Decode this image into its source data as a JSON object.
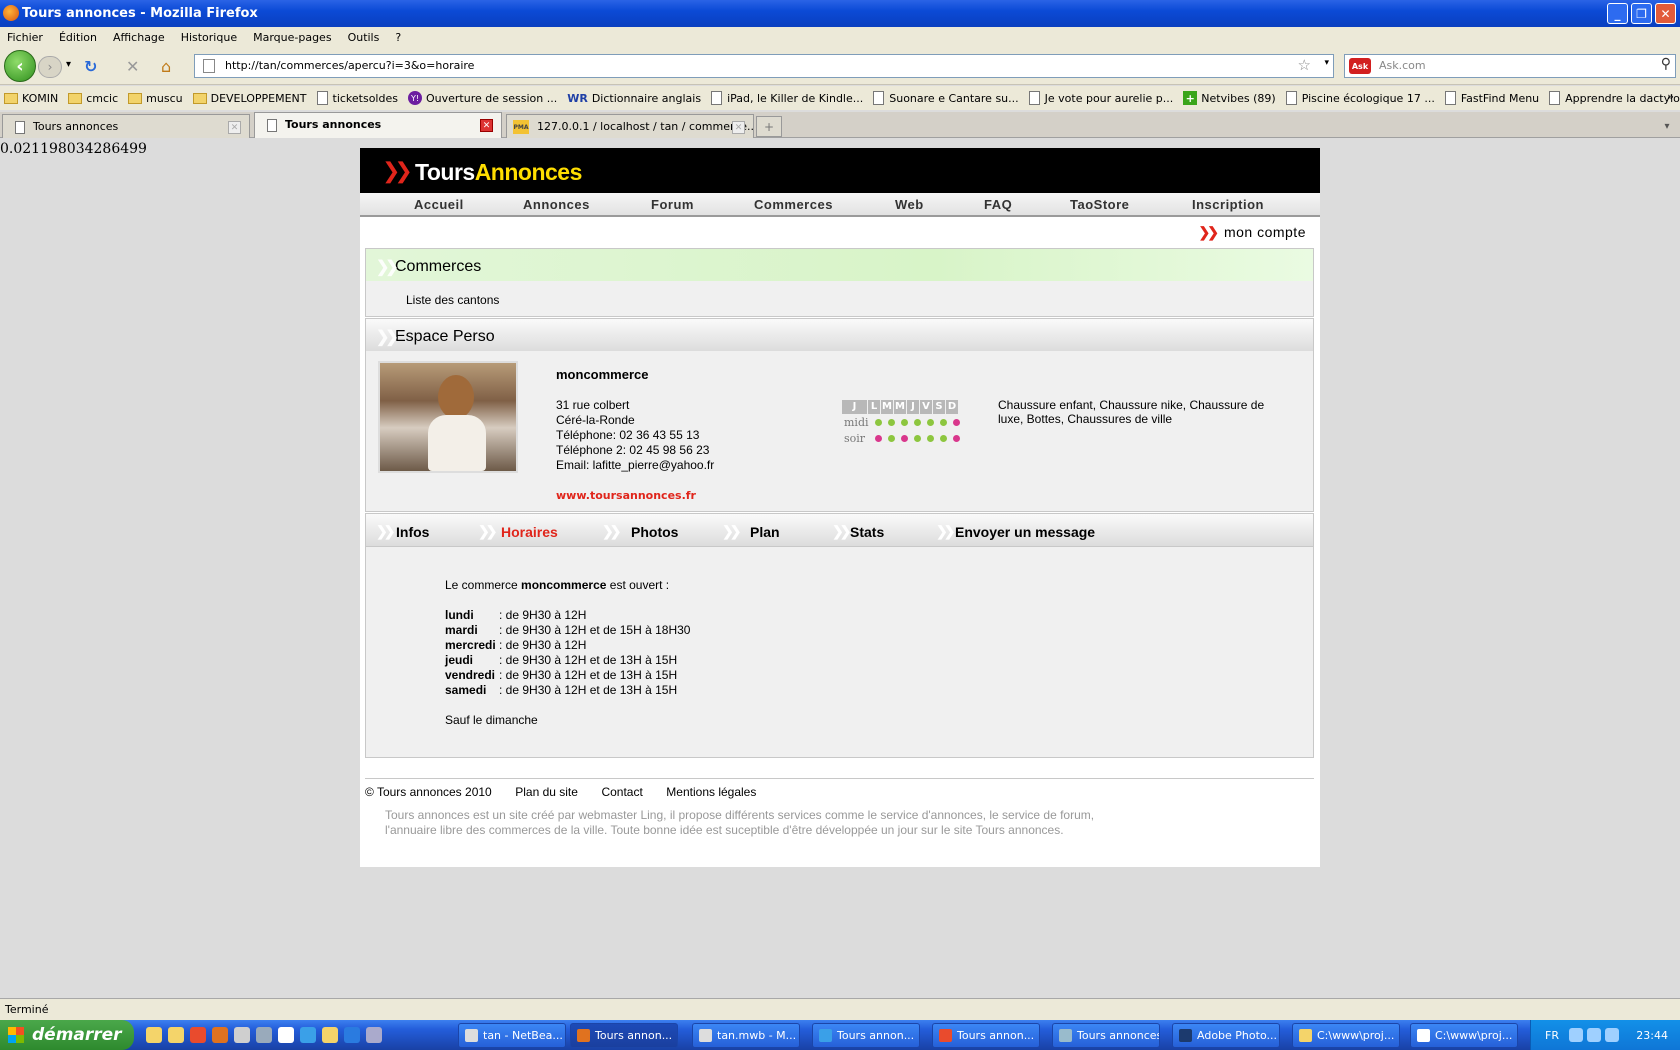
{
  "window": {
    "title": "Tours annonces - Mozilla Firefox"
  },
  "menu": [
    "Fichier",
    "Édition",
    "Affichage",
    "Historique",
    "Marque-pages",
    "Outils",
    "?"
  ],
  "url": "http://tan/commerces/apercu?i=3&o=horaire",
  "search_placeholder": "Ask.com",
  "bookmarks": [
    {
      "label": "KOMIN",
      "icon": "folder-icon"
    },
    {
      "label": "cmcic",
      "icon": "folder-icon"
    },
    {
      "label": "muscu",
      "icon": "folder-icon"
    },
    {
      "label": "DEVELOPPEMENT",
      "icon": "folder-icon"
    },
    {
      "label": "ticketsoldes",
      "icon": "page-icon"
    },
    {
      "label": "Ouverture de session ...",
      "icon": "yahoo-icon"
    },
    {
      "label": "Dictionnaire anglais",
      "icon": "wordreference-icon"
    },
    {
      "label": "iPad, le Killer de Kindle...",
      "icon": "page-icon"
    },
    {
      "label": "Suonare e Cantare su...",
      "icon": "page-icon"
    },
    {
      "label": "Je vote pour aurelie p...",
      "icon": "page-icon"
    },
    {
      "label": "Netvibes (89)",
      "icon": "netvibes-icon"
    },
    {
      "label": "Piscine écologique 17 ...",
      "icon": "page-icon"
    },
    {
      "label": "FastFind Menu",
      "icon": "page-icon"
    },
    {
      "label": "Apprendre la dactylog...",
      "icon": "page-icon"
    }
  ],
  "tabs": [
    "Tours annonces",
    "Tours annonces",
    "127.0.0.1 / localhost / tan / commerce..."
  ],
  "debug_value": "0.021198034286499",
  "site": {
    "brand_white": "Tours",
    "brand_yellow": "Annonces",
    "nav": [
      "Accueil",
      "Annonces",
      "Forum",
      "Commerces",
      "Web",
      "FAQ",
      "TaoStore",
      "Inscription"
    ],
    "mon_compte": "mon compte",
    "section_commerces": "Commerces",
    "liste_cantons": "Liste des cantons",
    "section_espace": "Espace Perso",
    "shop": {
      "name": "moncommerce",
      "address": "31 rue colbert",
      "city": "Céré-la-Ronde",
      "phone1": "Téléphone: 02 36 43 55 13",
      "phone2": "Téléphone 2: 02 45 98 56 23",
      "email": "Email: lafitte_pierre@yahoo.fr",
      "website": "www.toursannonces.fr",
      "categories": "Chaussure enfant, Chaussure nike, Chaussure de luxe, Bottes, Chaussures de ville"
    },
    "schedule": {
      "head": "J",
      "days": [
        "L",
        "M",
        "M",
        "J",
        "V",
        "S",
        "D"
      ],
      "midi_label": "midi",
      "soir_label": "soir",
      "midi": [
        true,
        true,
        true,
        true,
        true,
        true,
        false
      ],
      "soir": [
        false,
        true,
        false,
        true,
        true,
        true,
        false
      ],
      "open_color": "#8dc63f",
      "closed_color": "#d9378c"
    },
    "subtabs": [
      "Infos",
      "Horaires",
      "Photos",
      "Plan",
      "Stats",
      "Envoyer un message"
    ],
    "active_subtab": "Horaires",
    "hours_intro_pre": "Le commerce",
    "hours_intro_name": "moncommerce",
    "hours_intro_post": "est ouvert :",
    "hours": [
      {
        "day": "lundi",
        "time": ": de 9H30 à 12H"
      },
      {
        "day": "mardi",
        "time": ": de 9H30 à 12H et de 15H à 18H30"
      },
      {
        "day": "mercredi",
        "time": ": de 9H30 à 12H"
      },
      {
        "day": "jeudi",
        "time": ": de 9H30 à 12H et de 13H à 15H"
      },
      {
        "day": "vendredi",
        "time": ": de 9H30 à 12H et de 13H à 15H"
      },
      {
        "day": "samedi",
        "time": ": de 9H30 à 12H et de 13H à 15H"
      }
    ],
    "hours_note": "Sauf le dimanche",
    "footer_links": [
      "© Tours annonces 2010",
      "Plan du site",
      "Contact",
      "Mentions légales"
    ],
    "footer_desc": "Tours annonces est un site créé par webmaster Ling, il propose différents services comme le service d'annonces, le service de forum, l'annuaire libre des commerces de la ville. Toute bonne idée est suceptible d'être développée un jour sur le site Tours annonces."
  },
  "status": "Terminé",
  "taskbar": {
    "start": "démarrer",
    "items": [
      "tan - NetBea...",
      "Tours annon...",
      "tan.mwb - M...",
      "Tours annon...",
      "Tours annon...",
      "Tours annonces",
      "Adobe Photo...",
      "C:\\www\\proj...",
      "C:\\www\\proj..."
    ],
    "lang": "FR",
    "clock": "23:44"
  },
  "accent": "#e0251b"
}
